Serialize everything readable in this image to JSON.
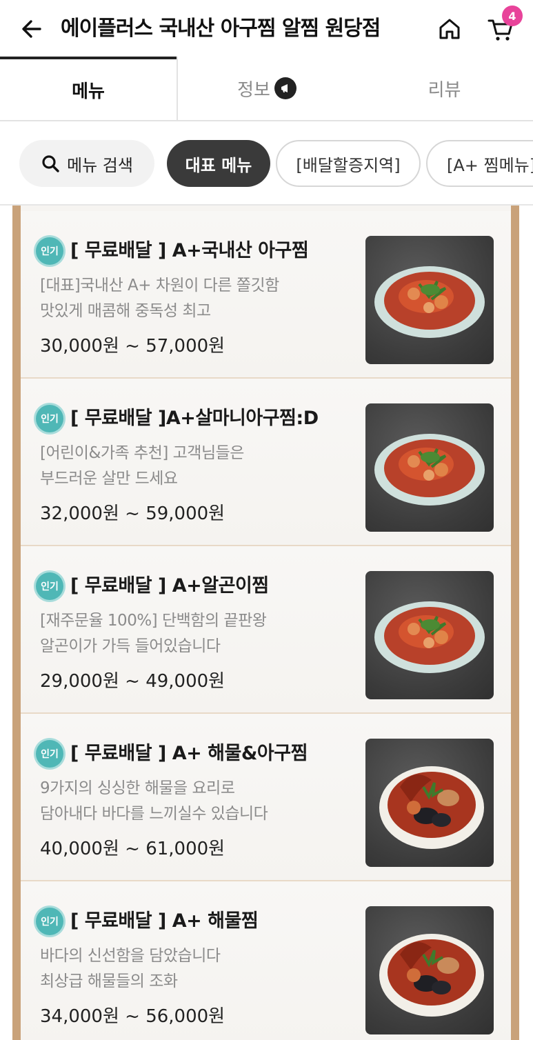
{
  "header": {
    "title": "에이플러스 국내산 아구찜 알찜 원당점",
    "cart_count": "4"
  },
  "tabs": [
    {
      "label": "메뉴"
    },
    {
      "label": "정보"
    },
    {
      "label": "리뷰"
    }
  ],
  "chips": {
    "search_label": "메뉴 검색",
    "items": [
      "대표 메뉴",
      "[배달할증지역]",
      "[A+ 찜메뉴]"
    ]
  },
  "badge_label": "인기",
  "menu_items": [
    {
      "name": "[ 무료배달 ] A+국내산 아구찜",
      "desc_line1": "[대표]국내산 A+ 차원이 다른 쫄깃함",
      "desc_line2": "맛있게 매콤해 중독성 최고",
      "price": "30,000원 ~ 57,000원",
      "image": "spicy-monkfish-plate"
    },
    {
      "name": "[ 무료배달 ]A+살마니아구찜:D",
      "desc_line1": "[어린이&가족 추천] 고객님들은",
      "desc_line2": "부드러운 살만 드세요",
      "price": "32,000원 ~ 59,000원",
      "image": "spicy-monkfish-plate"
    },
    {
      "name": "[ 무료배달 ] A+알곤이찜",
      "desc_line1": "[재주문율 100%] 단백함의 끝판왕",
      "desc_line2": "알곤이가 가득 들어있습니다",
      "price": "29,000원 ~ 49,000원",
      "image": "spicy-monkfish-plate"
    },
    {
      "name": "[ 무료배달 ] A+ 해물&아구찜",
      "desc_line1": "9가지의 싱싱한 해물을 요리로",
      "desc_line2": "담아내다 바다를 느끼실수 있습니다",
      "price": "40,000원 ~ 61,000원",
      "image": "seafood-bowl"
    },
    {
      "name": "[ 무료배달 ] A+ 해물찜",
      "desc_line1": "바다의 신선함을 담았습니다",
      "desc_line2": "최상급 해물들의 조화",
      "price": "34,000원 ~ 56,000원",
      "image": "seafood-bowl"
    }
  ],
  "colors": {
    "badge_teal": "#4fb7b6",
    "cart_badge_pink": "#e8439a",
    "list_border_tan": "#c9a27a",
    "active_chip_dark": "#3a3a3a"
  }
}
